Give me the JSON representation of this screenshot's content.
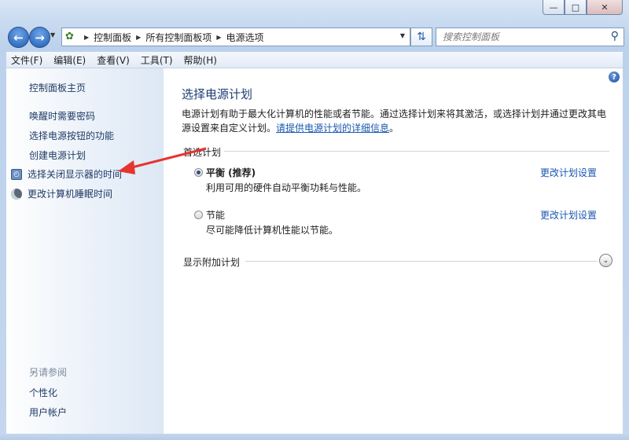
{
  "window": {
    "caption_buttons": {
      "minimize": "—",
      "maximize": "□",
      "close": "✕"
    }
  },
  "nav": {
    "back_icon": "arrow-left-icon",
    "forward_icon": "arrow-right-icon",
    "breadcrumbs": [
      "控制面板",
      "所有控制面板项",
      "电源选项"
    ],
    "search_placeholder": "搜索控制面板"
  },
  "menubar": {
    "items": [
      "文件(F)",
      "编辑(E)",
      "查看(V)",
      "工具(T)",
      "帮助(H)"
    ]
  },
  "sidebar": {
    "home": "控制面板主页",
    "links": [
      "唤醒时需要密码",
      "选择电源按钮的功能",
      "创建电源计划",
      "选择关闭显示器的时间",
      "更改计算机睡眠时间"
    ],
    "see_also_title": "另请参阅",
    "see_also": [
      "个性化",
      "用户帐户"
    ]
  },
  "main": {
    "title": "选择电源计划",
    "intro": "电源计划有助于最大化计算机的性能或者节能。通过选择计划来将其激活，或选择计划并通过更改其电源设置来自定义计划。",
    "intro_link": "请提供电源计划的详细信息",
    "intro_end": "。",
    "preferred_title": "首选计划",
    "plans": [
      {
        "name": "平衡 (推荐)",
        "desc": "利用可用的硬件自动平衡功耗与性能。",
        "link": "更改计划设置",
        "selected": true
      },
      {
        "name": "节能",
        "desc": "尽可能降低计算机性能以节能。",
        "link": "更改计划设置",
        "selected": false
      }
    ],
    "extra_title": "显示附加计划"
  },
  "colors": {
    "link": "#1a57b0",
    "title": "#1a3c73",
    "annotation_arrow": "#e8332f"
  }
}
